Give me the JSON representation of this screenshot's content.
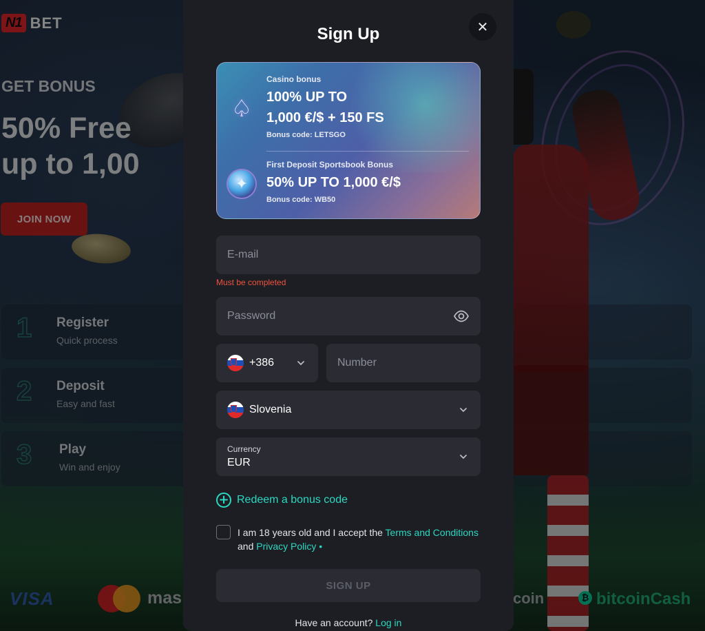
{
  "background": {
    "logo": {
      "badge": "N1",
      "name": "BET"
    },
    "hero": {
      "subtitle": "GET BONUS",
      "title_line1": "50% Free",
      "title_line2": "up to 1,00",
      "join_label": "JOIN NOW"
    },
    "steps": [
      {
        "num": "1",
        "title": "Register",
        "desc": "Quick process"
      },
      {
        "num": "2",
        "title": "Deposit",
        "desc": "Easy and fast"
      },
      {
        "num": "3",
        "title": "Play",
        "desc": "Win and enjoy"
      }
    ],
    "payments": {
      "visa": "VISA",
      "mastercard": "mas",
      "coin": "coin",
      "bitcoin_cash": "bitcoinCash"
    }
  },
  "modal": {
    "title": "Sign Up",
    "close_icon": "close-icon",
    "bonuses": [
      {
        "icon": "spade-icon",
        "label": "Casino bonus",
        "amount_line1": "100% UP TO",
        "amount_line2": "1,000 €/$ + 150 FS",
        "code_prefix": "Bonus code:",
        "code": "LETSGO"
      },
      {
        "icon": "sports-ball-icon",
        "label": "First Deposit Sportsbook Bonus",
        "amount_line1": "50% UP TO 1,000 €/$",
        "code_prefix": "Bonus code:",
        "code": "WB50"
      }
    ],
    "email": {
      "placeholder": "E-mail",
      "value": "",
      "error": "Must be completed"
    },
    "password": {
      "placeholder": "Password",
      "value": ""
    },
    "phone": {
      "country_code": "+386",
      "number_placeholder": "Number",
      "number_value": ""
    },
    "country": {
      "value": "Slovenia"
    },
    "currency": {
      "label": "Currency",
      "value": "EUR"
    },
    "redeem_label": "Redeem a bonus code",
    "terms": {
      "prefix": "I am 18 years old and I accept the ",
      "terms_link": "Terms and Conditions",
      "and": "and ",
      "privacy_link": "Privacy Policy",
      "required_mark": " •",
      "checked": false
    },
    "signup_label": "SIGN UP",
    "login": {
      "prompt": "Have an account? ",
      "link": "Log in"
    }
  },
  "colors": {
    "accent": "#2bd8c0",
    "error": "#f0523d",
    "modal_bg": "#1d1e24",
    "field_bg": "#2a2b33",
    "brand_red": "#d6232a"
  }
}
